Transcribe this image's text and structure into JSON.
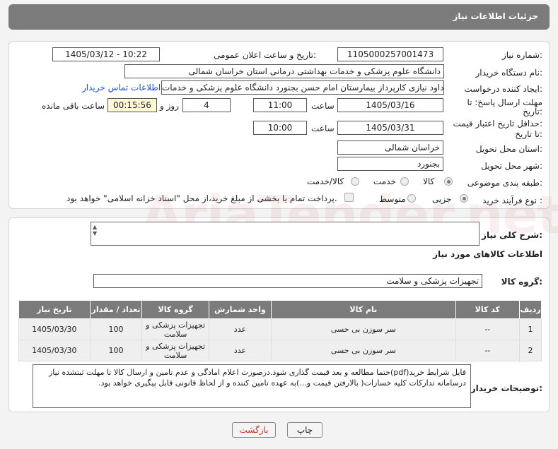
{
  "header": {
    "title": "جزئیات اطلاعات نیاز"
  },
  "form": {
    "need_number_label": "شماره نیاز:",
    "need_number": "1105000257001473",
    "announce_label": "تاریخ و ساعت اعلان عمومی:",
    "announce_value": "1405/03/12 - 10:22",
    "buyer_org_label": "نام دستگاه خریدار:",
    "buyer_org": "دانشگاه علوم پزشکی و خدمات بهداشتی درمانی استان خراسان شمالی",
    "requester_label": "ایجاد کننده درخواست:",
    "requester": "داود نیازی کارپرداز بیمارستان امام حسن بجنورد دانشگاه علوم پزشکی و خدمات",
    "contact_link": "اطلاعات تماس خریدار",
    "deadline_label_1": "مهلت ارسال پاسخ: تا",
    "deadline_label_2": "تاریخ:",
    "deadline_date": "1405/03/16",
    "time_word": "ساعت",
    "deadline_time": "11:00",
    "days_value": "4",
    "days_word": "روز و",
    "remaining_time": "00:15:56",
    "remaining_word": "ساعت باقی مانده",
    "validity_label_1": "حداقل تاریخ اعتبار قیمت:",
    "validity_label_2": "تا تاریخ:",
    "validity_date": "1405/03/31",
    "validity_time": "10:00",
    "province_label": "استان محل تحویل:",
    "province": "خراسان شمالی",
    "city_label": "شهر محل تحویل:",
    "city": "بجنورد",
    "category_label": "طبقه بندی موضوعی:",
    "category_options": [
      "کالا",
      "خدمت",
      "کالا/خدمت"
    ],
    "purchase_type_label": "نوع فرآیند خرید :",
    "purchase_options": [
      "جزیی",
      "متوسط"
    ],
    "payment_note": "پرداخت تمام یا بخشی از مبلغ خرید،از محل \"اسناد خزانه اسلامی\" خواهد بود."
  },
  "details": {
    "description_label": "شرح کلی نیاز:",
    "goods_info_title": "اطلاعات کالاهای مورد نیاز",
    "goods_group_label": "گروه کالا:",
    "goods_group": "تجهیزات پزشکی و سلامت",
    "buyer_notes_label": "توضیحات خریدار:",
    "buyer_notes": "فایل شرایط خرید(pdf)حتما مطالعه و بعد قیمت گذاری شود.درصورت اعلام امادگی و عدم تامین و ارسال کالا تا مهلت ثبتشده نیاز درسامانه تدارکات کلیه خسارات( بالارفتن قیمت و...)به عهده تامین کننده و از لحاظ قانونی قابل پیگیری خواهد بود."
  },
  "table": {
    "headers": [
      "ردیف",
      "کد کالا",
      "نام کالا",
      "واحد شمارش",
      "گروه کالا",
      "تعداد / مقدار",
      "تاریخ نیاز"
    ],
    "rows": [
      [
        "1",
        "--",
        "سر سوزن بی حسی",
        "عدد",
        "تجهیزات پزشکی و سلامت",
        "100",
        "1405/03/30"
      ],
      [
        "2",
        "--",
        "سر سوزن بی حسی",
        "عدد",
        "تجهیزات پزشکی و سلامت",
        "100",
        "1405/03/30"
      ]
    ]
  },
  "buttons": {
    "print": "چاپ",
    "back": "بازگشت"
  },
  "watermark": "AriaTender.net",
  "colors": {
    "header_bg": "#7b7b7b",
    "link": "#1a4fd6",
    "back_text": "#c0392b"
  }
}
